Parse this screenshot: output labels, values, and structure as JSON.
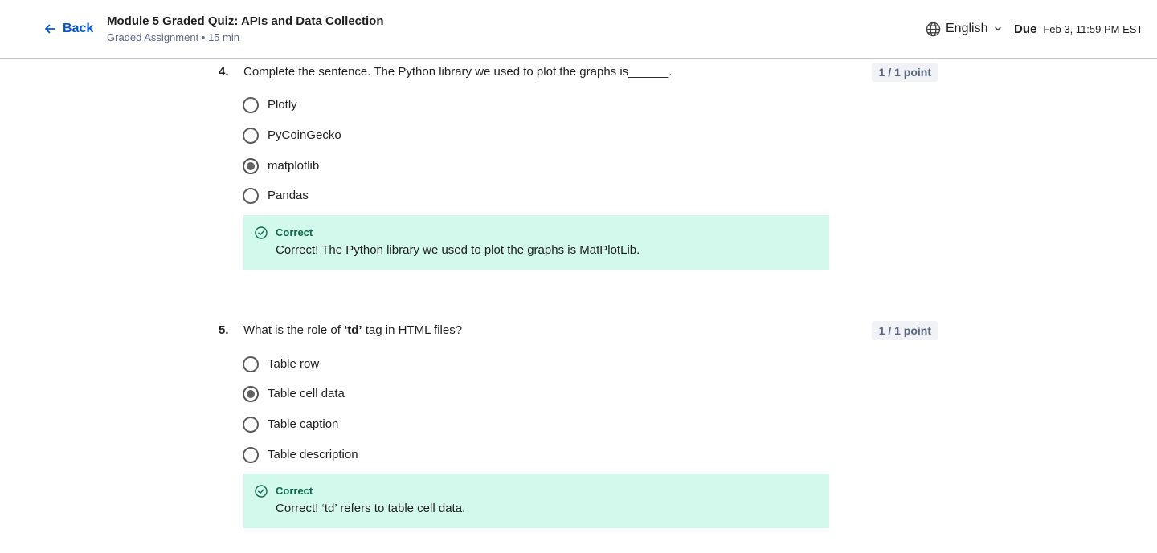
{
  "header": {
    "back_label": "Back",
    "title": "Module 5 Graded Quiz: APIs and Data Collection",
    "subtitle": "Graded Assignment • 15 min",
    "language": "English",
    "due_label": "Due",
    "due_value": "Feb 3, 11:59 PM EST"
  },
  "questions": [
    {
      "number": "4.",
      "text": "Complete the sentence. The Python library we used to plot the graphs is______.",
      "points": "1 / 1 point",
      "options": [
        {
          "label": "Plotly",
          "selected": false
        },
        {
          "label": "PyCoinGecko",
          "selected": false
        },
        {
          "label": "matplotlib",
          "selected": true
        },
        {
          "label": "Pandas",
          "selected": false
        }
      ],
      "feedback_title": "Correct",
      "feedback_text": "Correct! The Python library we used to plot the graphs is MatPlotLib."
    },
    {
      "number": "5.",
      "text_before": "What is the role of ",
      "text_bold": "‘td’",
      "text_after": " tag in HTML files?",
      "points": "1 / 1 point",
      "options": [
        {
          "label": "Table row",
          "selected": false
        },
        {
          "label": "Table cell data",
          "selected": true
        },
        {
          "label": "Table caption",
          "selected": false
        },
        {
          "label": "Table description",
          "selected": false
        }
      ],
      "feedback_title": "Correct",
      "feedback_text": "Correct! ‘td’ refers to table cell data."
    }
  ],
  "colors": {
    "link": "#0056d2",
    "feedback_bg": "#d2f9ec",
    "feedback_title": "#0b6b4b",
    "points_bg": "#f0f2f5"
  },
  "icons": [
    "arrow-left-icon",
    "globe-icon",
    "chevron-down-icon",
    "check-circle-icon"
  ]
}
